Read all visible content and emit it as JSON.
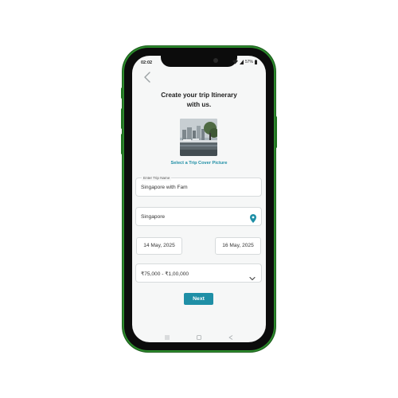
{
  "status_bar": {
    "time": "02:02",
    "battery": "57%"
  },
  "page": {
    "title_line1": "Create your trip Itinerary",
    "title_line2": "with us.",
    "cover_link": "Select a Trip Cover Picture"
  },
  "form": {
    "trip_name": {
      "label": "Enter Trip Name",
      "value": "Singapore with Fam"
    },
    "destination": {
      "value": "Singapore"
    },
    "start_date": "14 May, 2025",
    "end_date": "16 May, 2025",
    "budget": {
      "selected": "₹75,000 - ₹1,00,000"
    },
    "next_label": "Next"
  },
  "icons": {
    "back": "chevron-left-icon",
    "location": "location-pin-icon",
    "dropdown": "chevron-down-icon",
    "nav_menu": "menu-icon",
    "nav_home": "square-home-icon",
    "nav_back": "triangle-back-icon"
  },
  "colors": {
    "accent": "#1f8fa6",
    "phone_frame": "#2c8a2c"
  }
}
